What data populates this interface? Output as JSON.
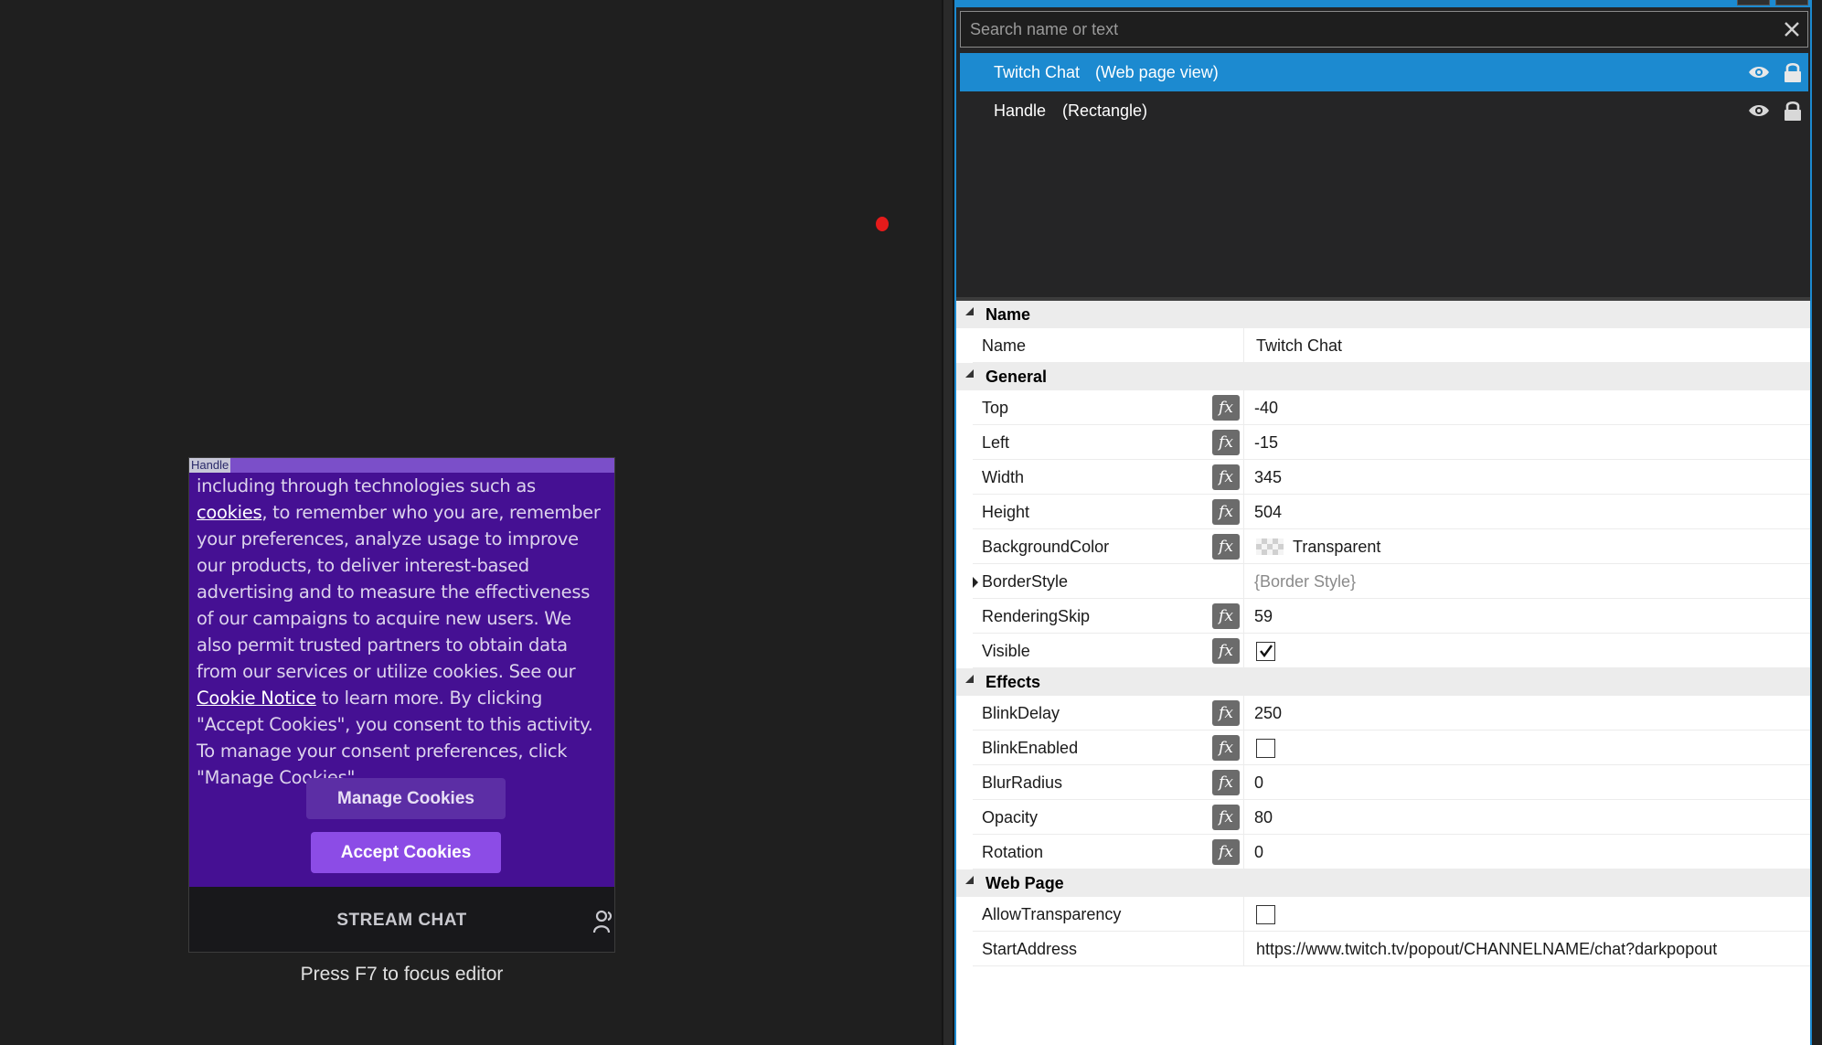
{
  "canvas": {
    "handle_label": "Handle",
    "cookie_text": {
      "line1_prefix": "including through technologies such as ",
      "cookies_link": "cookies",
      "line1_suffix": ",",
      "middle": "to remember who you are, remember your preferences, analyze usage to improve our products, to deliver interest-based advertising and to measure the effectiveness of our campaigns to acquire new users. We also permit trusted partners to obtain data from our services or utilize cookies. See our ",
      "notice_link": "Cookie Notice",
      "tail": " to learn more. By clicking \"Accept Cookies\", you consent to this activity. To manage your consent preferences, click \"Manage Cookies\"."
    },
    "manage_button": "Manage Cookies",
    "accept_button": "Accept Cookies",
    "stream_chat": "STREAM CHAT",
    "focus_hint": "Press F7 to focus editor"
  },
  "search": {
    "placeholder": "Search name or text"
  },
  "layers": [
    {
      "name": "Twitch Chat",
      "type": "(Web page view)",
      "selected": true
    },
    {
      "name": "Handle",
      "type": "(Rectangle)",
      "selected": false
    }
  ],
  "properties": {
    "fx_label": "fx",
    "categories": {
      "name": "Name",
      "general": "General",
      "effects": "Effects",
      "webpage": "Web Page"
    },
    "name_row": {
      "label": "Name",
      "value": "Twitch Chat"
    },
    "top": {
      "label": "Top",
      "value": "-40"
    },
    "left": {
      "label": "Left",
      "value": "-15"
    },
    "width": {
      "label": "Width",
      "value": "345"
    },
    "height": {
      "label": "Height",
      "value": "504"
    },
    "background_color": {
      "label": "BackgroundColor",
      "value": "Transparent"
    },
    "border_style": {
      "label": "BorderStyle",
      "value": "{Border Style}"
    },
    "rendering_skip": {
      "label": "RenderingSkip",
      "value": "59"
    },
    "visible": {
      "label": "Visible",
      "checked": true
    },
    "blink_delay": {
      "label": "BlinkDelay",
      "value": "250"
    },
    "blink_enabled": {
      "label": "BlinkEnabled",
      "checked": false
    },
    "blur_radius": {
      "label": "BlurRadius",
      "value": "0"
    },
    "opacity": {
      "label": "Opacity",
      "value": "80"
    },
    "rotation": {
      "label": "Rotation",
      "value": "0"
    },
    "allow_transparency": {
      "label": "AllowTransparency",
      "checked": false
    },
    "start_address": {
      "label": "StartAddress",
      "value": "https://www.twitch.tv/popout/CHANNELNAME/chat?darkpopout"
    }
  },
  "colors": {
    "accent": "#1c8ad0",
    "cookie_panel": "#451093",
    "accept_button": "#8c4ce6"
  }
}
